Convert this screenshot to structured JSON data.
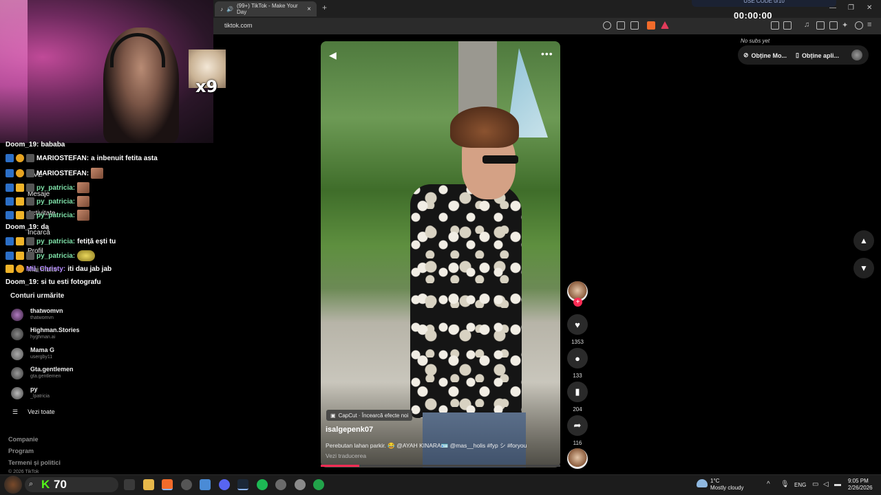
{
  "overlay": {
    "cat_multiplier": "x9",
    "timer_top": "USE CODE 0/10",
    "timer": "00:00:00",
    "no_subs": "No subs yet"
  },
  "chat": [
    {
      "user": "Doom_19:",
      "msg": "bababa",
      "color": "white",
      "badges": 0,
      "emote": null
    },
    {
      "user": "MARIOSTEFAN:",
      "msg": "a inbenuit fetita asta",
      "color": "white",
      "badges": 3,
      "emote": null
    },
    {
      "user": "MARIOSTEFAN:",
      "msg": "",
      "color": "white",
      "badges": 3,
      "emote": "square"
    },
    {
      "user": "py_patricia:",
      "msg": "",
      "color": "green",
      "badges": 3,
      "emote": "square"
    },
    {
      "user": "py_patricia:",
      "msg": "",
      "color": "green",
      "badges": 3,
      "emote": "square"
    },
    {
      "user": "py_patricia:",
      "msg": "",
      "color": "green",
      "badges": 3,
      "emote": "square"
    },
    {
      "user": "Doom_19:",
      "msg": "da",
      "color": "white",
      "badges": 0,
      "emote": null
    },
    {
      "user": "py_patricia:",
      "msg": "fetiță ești tu",
      "color": "green",
      "badges": 3,
      "emote": null
    },
    {
      "user": "py_patricia:",
      "msg": "",
      "color": "green",
      "badges": 3,
      "emote": "glasses"
    },
    {
      "user": "Mil_Christy:",
      "msg": "iti dau jab jab",
      "color": "purple",
      "badges": 2,
      "emote": null
    },
    {
      "user": "Doom_19:",
      "msg": "si tu esti fotografu",
      "color": "white",
      "badges": 0,
      "emote": null
    }
  ],
  "tiktok_nav_ghost": {
    "live": "LIVE",
    "messages": "Mesaje",
    "activity": "Activitate",
    "upload": "Încarcă",
    "profile": "Profil",
    "more": "Mai multe"
  },
  "followed": {
    "title": "Conturi urmărite",
    "accounts": [
      {
        "name": "thatwomvn",
        "handle": "thatwomvn"
      },
      {
        "name": "Highman.Stories",
        "handle": "hyghman.ai"
      },
      {
        "name": "Mama G",
        "handle": "usergby11"
      },
      {
        "name": "Gta.gentlemen",
        "handle": "gta.gentlemen"
      },
      {
        "name": "py",
        "handle": "_lpatricia"
      }
    ],
    "see_all": "Vezi toate"
  },
  "footer": {
    "company": "Companie",
    "program": "Program",
    "terms": "Termeni și politici",
    "copyright": "© 2026 TikTok"
  },
  "browser": {
    "tab_title": "(99+) TikTok - Make Your Day",
    "url": "tiktok.com",
    "new_tab": "+",
    "close_tab": "×"
  },
  "tiktok_top": {
    "get_coins": "Obține Mo...",
    "get_app": "Obține apli..."
  },
  "video": {
    "capcut": "CapCut · Încearcă efecte noi",
    "author": "isalgepenk07",
    "description": "Perebutan lahan parkir. 😂 @AYAH KINARA🪪 @mas__holis #fyp シ #foryou",
    "translate": "Vezi traducerea",
    "progress_fraction": 0.16
  },
  "actions": {
    "likes": "1353",
    "comments": "133",
    "saves": "204",
    "shares": "116"
  },
  "taskbar": {
    "kick_k": "K",
    "kick_count": "70",
    "temp": "1°C",
    "weather": "Mostly cloudy",
    "lang": "ENG",
    "time": "9:05 PM",
    "date": "2/26/2026"
  },
  "colors": {
    "tiktok_red": "#fe2c55",
    "kick_green": "#53fc18",
    "chat_green": "#7ee0a8",
    "chat_purple": "#b58cff"
  }
}
